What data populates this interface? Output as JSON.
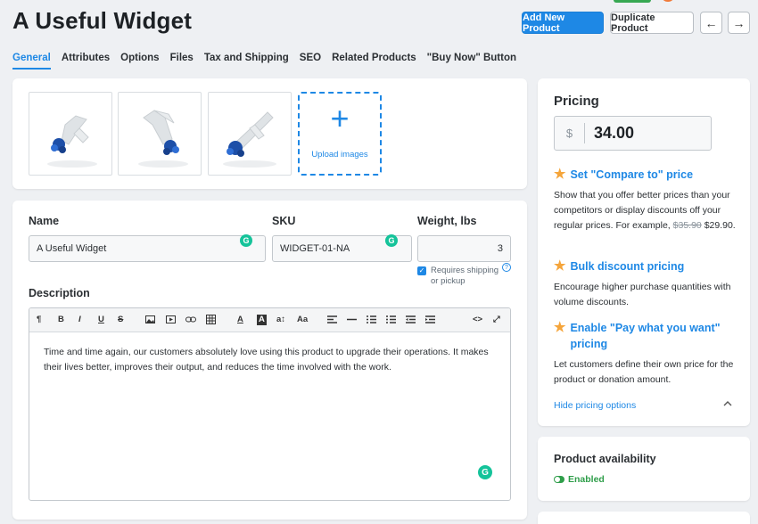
{
  "page": {
    "title": "A Useful Widget"
  },
  "header": {
    "add_new_label": "Add New Product",
    "duplicate_label": "Duplicate Product",
    "prev_icon": "←",
    "next_icon": "→"
  },
  "tabs": [
    "General",
    "Attributes",
    "Options",
    "Files",
    "Tax and Shipping",
    "SEO",
    "Related Products",
    "\"Buy Now\" Button"
  ],
  "images": {
    "upload_label": "Upload images",
    "plus": "+"
  },
  "fields": {
    "name_label": "Name",
    "name_value": "A Useful Widget",
    "sku_label": "SKU",
    "sku_value": "WIDGET-01-NA",
    "weight_label": "Weight, lbs",
    "weight_value": "3",
    "requires_shipping_line1": "Requires shipping",
    "requires_shipping_line2": "or pickup",
    "grammarly_badge": "G",
    "help_glyph": "?"
  },
  "description": {
    "label": "Description",
    "text": "Time and time again, our customers absolutely love using this product to upgrade their operations. It makes their lives better, improves their output, and reduces the time involved with the work.",
    "toolbar": {
      "paragraph": "¶",
      "bold": "B",
      "italic": "I",
      "underline": "U",
      "strike": "S",
      "font_color": "A",
      "bg_color": "A",
      "font_size": "a↕",
      "font_family": "Aa",
      "code": "<>",
      "fullscreen": "⤢"
    }
  },
  "pricing": {
    "title": "Pricing",
    "currency": "$",
    "price": "34.00",
    "star": "★",
    "compare_title": "Set \"Compare to\" price",
    "compare_desc_a": "Show that you offer better prices than your competitors or display discounts off your regular prices. For example, ",
    "compare_old_price": "$35.90",
    "compare_new_price": "$29.90.",
    "bulk_title": "Bulk discount pricing",
    "bulk_desc": "Encourage higher purchase quantities with volume discounts.",
    "pwyw_title_line1": "Enable \"Pay what you want\"",
    "pwyw_title_line2": "pricing",
    "pwyw_desc": "Let customers define their own price for the product or donation amount.",
    "hide_label": "Hide pricing options"
  },
  "availability": {
    "title": "Product availability",
    "status": "Enabled"
  },
  "colors": {
    "accent": "#1e88e5",
    "success": "#2f9e4a",
    "star": "#f5a53b",
    "grammarly": "#15c39a"
  }
}
